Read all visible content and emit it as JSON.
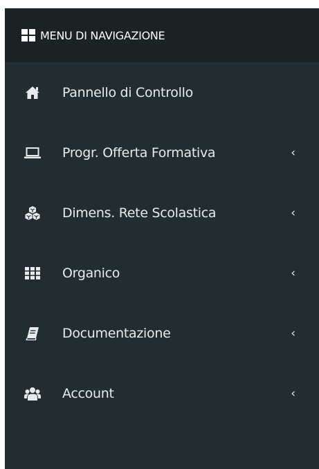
{
  "header": {
    "title": "MENU DI NAVIGAZIONE",
    "icon": "grid-icon"
  },
  "menu": {
    "items": [
      {
        "label": "Pannello di Controllo",
        "icon": "home-icon",
        "expandable": false
      },
      {
        "label": "Progr. Offerta Formativa",
        "icon": "laptop-icon",
        "expandable": true,
        "chevron": "‹"
      },
      {
        "label": "Dimens. Rete Scolastica",
        "icon": "cubes-icon",
        "expandable": true,
        "chevron": "‹"
      },
      {
        "label": "Organico",
        "icon": "table-grid-icon",
        "expandable": true,
        "chevron": "‹"
      },
      {
        "label": "Documentazione",
        "icon": "book-icon",
        "expandable": true,
        "chevron": "‹"
      },
      {
        "label": "Account",
        "icon": "users-icon",
        "expandable": true,
        "chevron": "‹"
      }
    ]
  },
  "colors": {
    "sidebar_bg": "#222d32",
    "header_bg": "#1a2226",
    "text": "#e6ecee"
  }
}
